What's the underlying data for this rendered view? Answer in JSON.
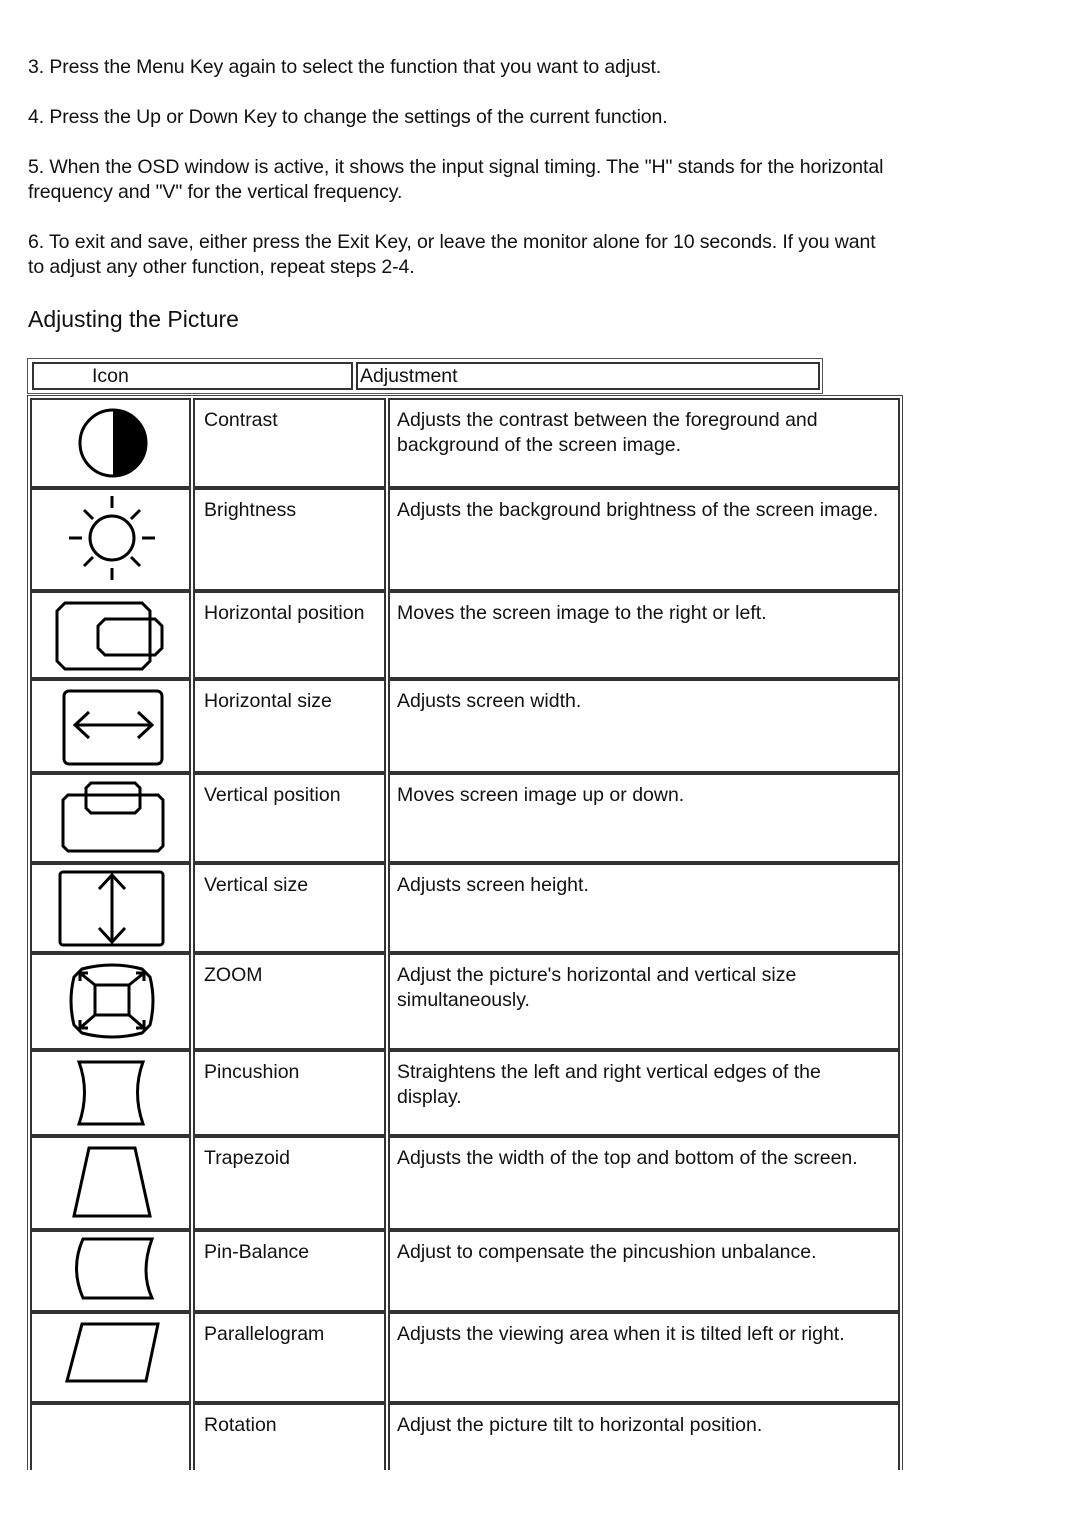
{
  "paragraphs": [
    "3. Press the Menu Key again to select the function that you want to adjust.",
    "4. Press the Up or Down Key to change the settings of the current function.",
    "5. When the OSD window is active, it shows the input signal timing. The \"H\" stands for the horizontal frequency and \"V\" for the vertical frequency.",
    "6. To exit and save, either press the Exit Key, or leave the monitor alone for 10 seconds. If you want to adjust any other function, repeat steps 2-4."
  ],
  "section_heading": "Adjusting the Picture",
  "table": {
    "headers": {
      "icon": "Icon",
      "adjustment": "Adjustment"
    },
    "rows": [
      {
        "icon": "contrast-icon",
        "name": "Contrast",
        "description": "Adjusts the contrast between the foreground and background of the screen image."
      },
      {
        "icon": "brightness-icon",
        "name": "Brightness",
        "description": "Adjusts the background brightness of the screen image."
      },
      {
        "icon": "horizontal-position-icon",
        "name": "Horizontal position",
        "description": "Moves the screen image to the right or left."
      },
      {
        "icon": "horizontal-size-icon",
        "name": "Horizontal size",
        "description": "Adjusts screen width."
      },
      {
        "icon": "vertical-position-icon",
        "name": "Vertical position",
        "description": "Moves screen image up or down."
      },
      {
        "icon": "vertical-size-icon",
        "name": "Vertical size",
        "description": "Adjusts screen height."
      },
      {
        "icon": "zoom-icon",
        "name": "ZOOM",
        "description": "Adjust the picture's horizontal and vertical size simultaneously."
      },
      {
        "icon": "pincushion-icon",
        "name": "Pincushion",
        "description": "Straightens the left and right vertical edges of the display."
      },
      {
        "icon": "trapezoid-icon",
        "name": "Trapezoid",
        "description": "Adjusts the width of the top and bottom of the screen."
      },
      {
        "icon": "pin-balance-icon",
        "name": "Pin-Balance",
        "description": "Adjust to compensate the pincushion unbalance."
      },
      {
        "icon": "parallelogram-icon",
        "name": "Parallelogram",
        "description": "Adjusts the viewing area when it is tilted left or right."
      },
      {
        "icon": "rotation-icon",
        "name": "Rotation",
        "description": "Adjust the picture tilt to horizontal position."
      }
    ]
  }
}
